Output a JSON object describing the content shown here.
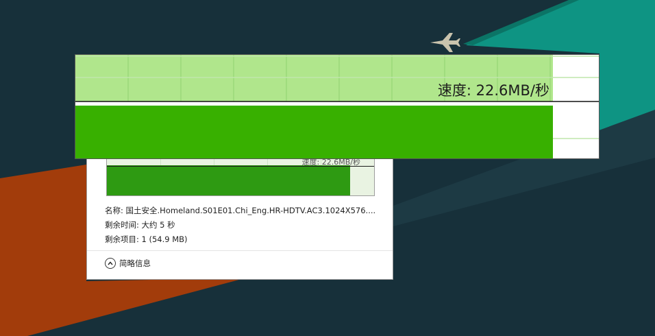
{
  "colors": {
    "desktop_bg": "#152a30",
    "teal_shape": "#0e9483",
    "orange_shape": "#a23c0b",
    "graph_fill": "#38b000",
    "graph_light": "#b0e68c",
    "graph_grid": "#9ad97a"
  },
  "speed_graph": {
    "speed_text": "速度: 22.6MB/秒",
    "progress_fraction": 0.91
  },
  "dialog": {
    "mini_speed_text": "速度: 22.6MB/秒",
    "name_line": "名称: 国土安全.Homeland.S01E01.Chi_Eng.HR-HDTV.AC3.1024X576....",
    "time_line": "剩余时间: 大约 5 秒",
    "items_line": "剩余项目: 1 (54.9 MB)",
    "less_details_label": "简略信息",
    "less_details_icon": "chevron-up-circle-icon"
  },
  "desktop": {
    "plane_icon": "airplane-icon"
  }
}
